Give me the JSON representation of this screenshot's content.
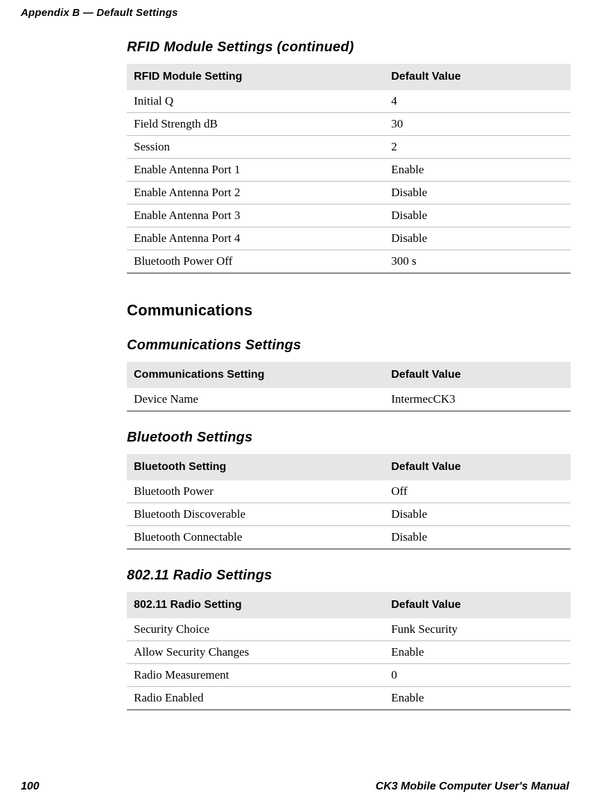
{
  "header": {
    "appendix": "Appendix B — Default Settings"
  },
  "sections": {
    "rfid": {
      "title": "RFID Module Settings (continued)",
      "col1": "RFID Module Setting",
      "col2": "Default Value",
      "rows": [
        {
          "setting": "Initial Q",
          "value": "4"
        },
        {
          "setting": "Field Strength dB",
          "value": "30"
        },
        {
          "setting": "Session",
          "value": "2"
        },
        {
          "setting": "Enable Antenna Port 1",
          "value": "Enable"
        },
        {
          "setting": "Enable Antenna Port 2",
          "value": "Disable"
        },
        {
          "setting": "Enable Antenna Port 3",
          "value": "Disable"
        },
        {
          "setting": "Enable Antenna Port 4",
          "value": "Disable"
        },
        {
          "setting": "Bluetooth Power Off",
          "value": "300 s"
        }
      ]
    },
    "comms_heading": "Communications",
    "comms": {
      "title": "Communications Settings",
      "col1": "Communications Setting",
      "col2": "Default Value",
      "rows": [
        {
          "setting": "Device Name",
          "value": "IntermecCK3"
        }
      ]
    },
    "bluetooth": {
      "title": "Bluetooth Settings",
      "col1": "Bluetooth Setting",
      "col2": "Default Value",
      "rows": [
        {
          "setting": "Bluetooth Power",
          "value": "Off"
        },
        {
          "setting": "Bluetooth Discoverable",
          "value": "Disable"
        },
        {
          "setting": "Bluetooth Connectable",
          "value": "Disable"
        }
      ]
    },
    "radio": {
      "title": "802.11 Radio Settings",
      "col1": "802.11 Radio Setting",
      "col2": "Default Value",
      "rows": [
        {
          "setting": "Security Choice",
          "value": "Funk Security"
        },
        {
          "setting": "Allow Security Changes",
          "value": "Enable"
        },
        {
          "setting": "Radio Measurement",
          "value": "0"
        },
        {
          "setting": "Radio Enabled",
          "value": "Enable"
        }
      ]
    }
  },
  "footer": {
    "page": "100",
    "manual": "CK3 Mobile Computer User's Manual"
  }
}
